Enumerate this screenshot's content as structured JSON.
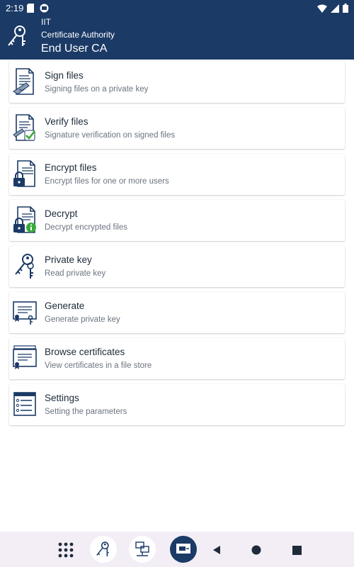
{
  "status": {
    "time": "2:19"
  },
  "header": {
    "org": "IIT",
    "subtitle": "Certificate Authority",
    "title": "End User CA"
  },
  "menu": [
    {
      "icon": "sign-document-icon",
      "title": "Sign files",
      "subtitle": "Signing files on a private key"
    },
    {
      "icon": "verify-document-icon",
      "title": "Verify files",
      "subtitle": "Signature verification on signed files"
    },
    {
      "icon": "encrypt-document-icon",
      "title": "Encrypt files",
      "subtitle": "Encrypt files for one or more users"
    },
    {
      "icon": "decrypt-document-icon",
      "title": "Decrypt",
      "subtitle": "Decrypt encrypted files"
    },
    {
      "icon": "keys-icon",
      "title": "Private key",
      "subtitle": "Read private key"
    },
    {
      "icon": "generate-certificate-icon",
      "title": "Generate",
      "subtitle": "Generate private key"
    },
    {
      "icon": "certificates-icon",
      "title": "Browse certificates",
      "subtitle": "View certificates in a file store"
    },
    {
      "icon": "settings-list-icon",
      "title": "Settings",
      "subtitle": "Setting the parameters"
    }
  ],
  "colors": {
    "header": "#1b3a66",
    "accent": "#1b3a66",
    "check": "#3aaa3a",
    "info": "#3aaa3a"
  }
}
